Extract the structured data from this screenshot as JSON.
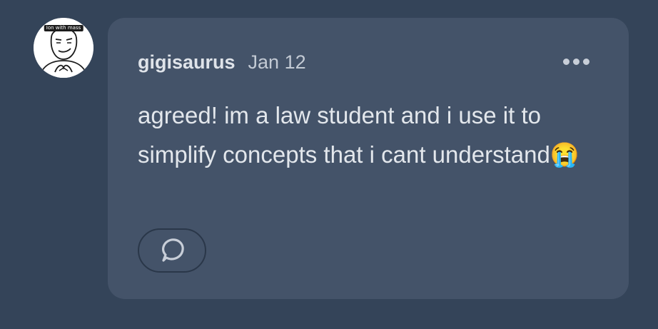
{
  "avatar": {
    "caption": "Ion with mass"
  },
  "comment": {
    "author": "gigisaurus",
    "date": "Jan 12",
    "text": "agreed! im a law student and i use it to simplify concepts that i cant understand😭"
  },
  "icons": {
    "more": "more-horizontal-icon",
    "reply": "speech-bubble-icon"
  },
  "colors": {
    "background": "#344459",
    "card": "#445369",
    "text": "#e3e7ec",
    "muted": "#c3cad4"
  }
}
